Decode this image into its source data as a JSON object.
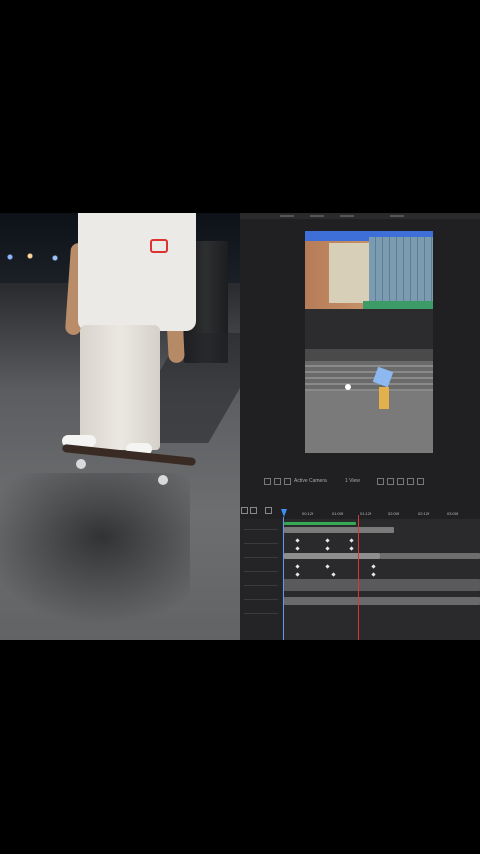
{
  "editor": {
    "toolbar": {
      "camera": "Active Camera",
      "views": "1 View"
    },
    "ruler_ticks": [
      "00:12f",
      "01:00f",
      "01:12f",
      "02:00f",
      "02:12f",
      "03:00f"
    ],
    "colors": {
      "playhead": "#d43a2f",
      "time_indicator": "#3d8ff0",
      "work_area": "#35a853",
      "layer_bar": "#8e8e8e"
    }
  },
  "icons": [
    "search-icon",
    "layer-icon",
    "camera-icon",
    "grid-icon",
    "keyframe-icon"
  ]
}
